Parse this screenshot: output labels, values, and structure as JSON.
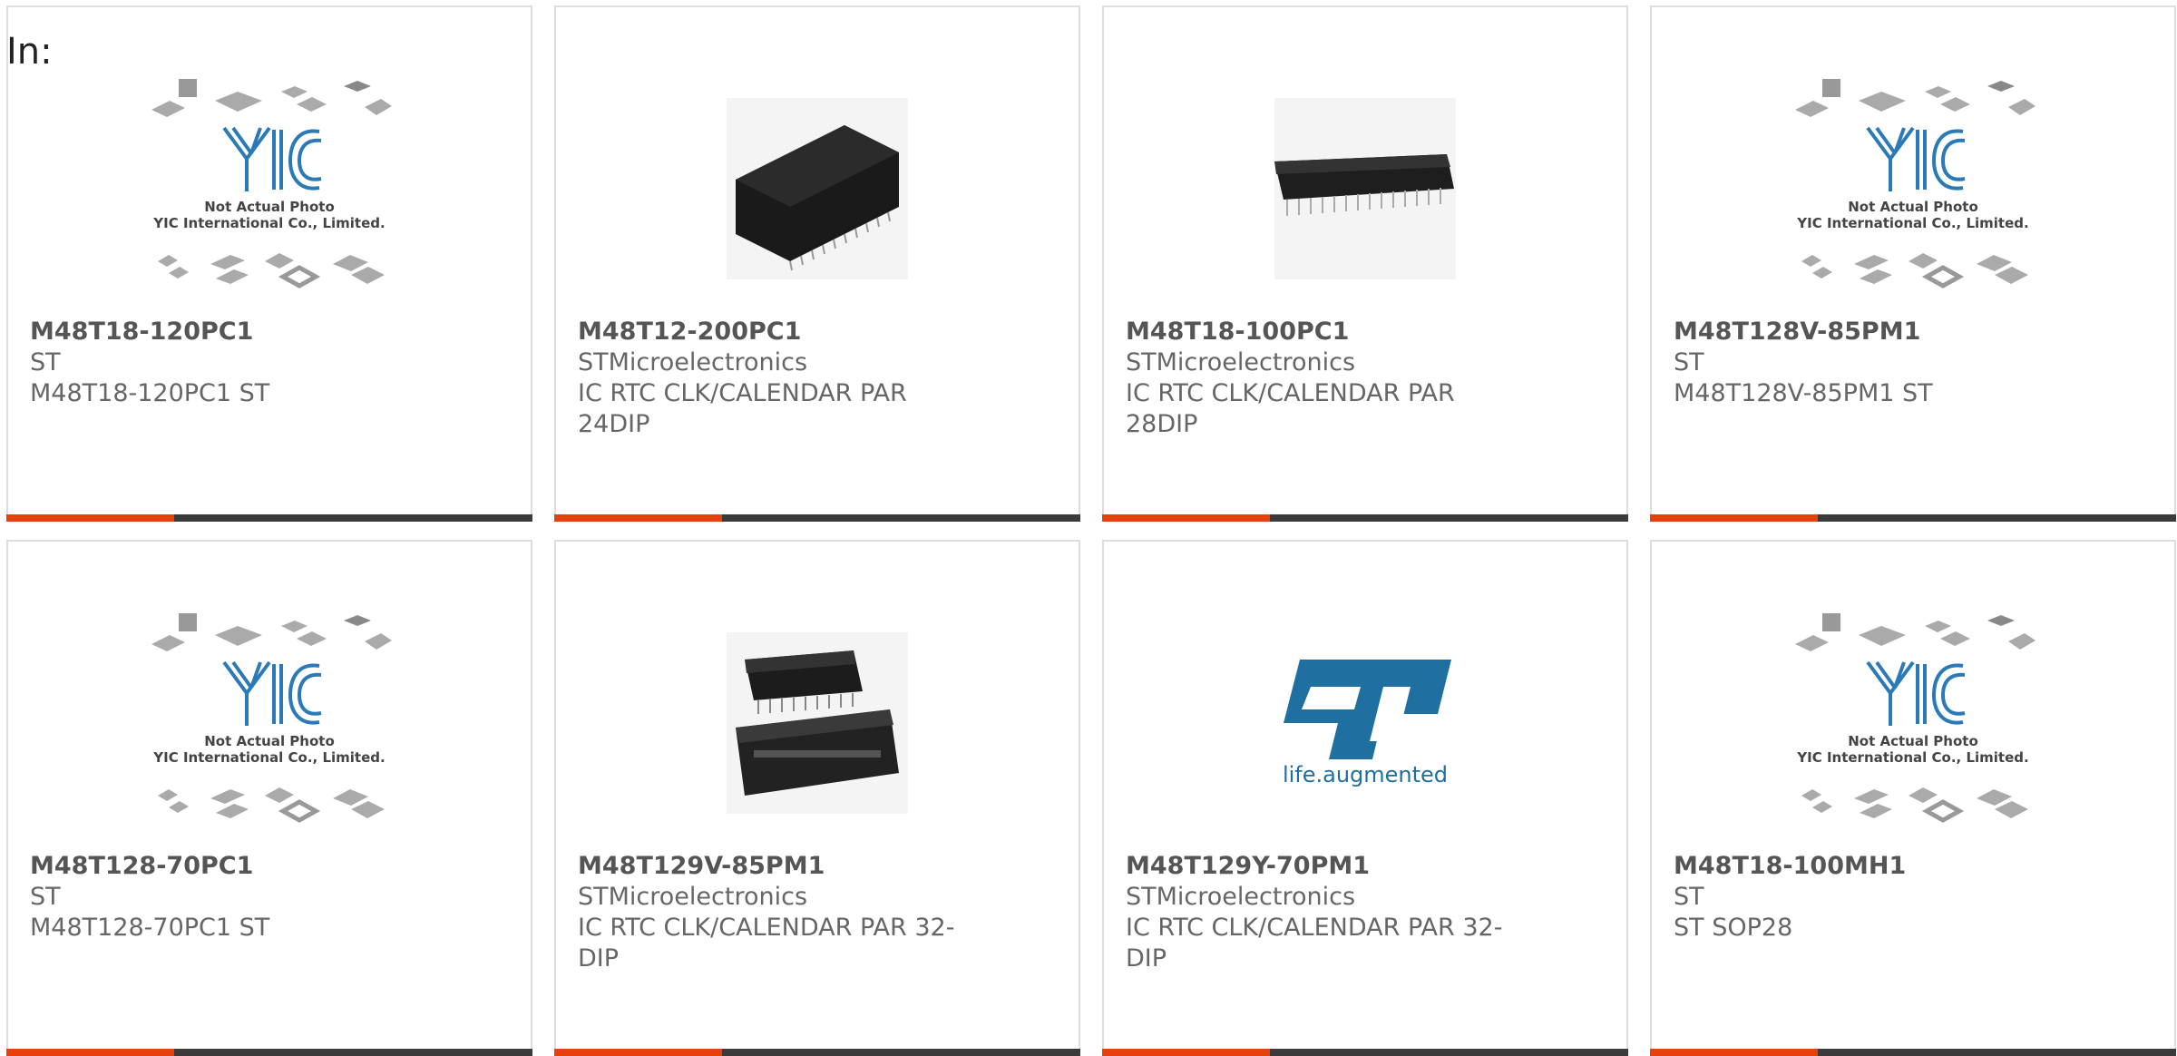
{
  "header": {
    "in_label": "In:"
  },
  "placeholder": {
    "line1": "Not Actual Photo",
    "line2": "YIC International Co., Limited."
  },
  "st_logo": {
    "text": "life.augmented"
  },
  "cards": [
    {
      "part": "M48T18-120PC1",
      "mfr": "ST",
      "desc": "M48T18-120PC1 ST",
      "image": "yic-placeholder"
    },
    {
      "part": "M48T12-200PC1",
      "mfr": "STMicroelectronics",
      "desc": "IC RTC CLK/CALENDAR PAR 24DIP",
      "image": "dip-module-chip"
    },
    {
      "part": "M48T18-100PC1",
      "mfr": "STMicroelectronics",
      "desc": "IC RTC CLK/CALENDAR PAR 28DIP",
      "image": "dip-28-chip"
    },
    {
      "part": "M48T128V-85PM1",
      "mfr": "ST",
      "desc": "M48T128V-85PM1 ST",
      "image": "yic-placeholder"
    },
    {
      "part": "M48T128-70PC1",
      "mfr": "ST",
      "desc": "M48T128-70PC1 ST",
      "image": "yic-placeholder"
    },
    {
      "part": "M48T129V-85PM1",
      "mfr": "STMicroelectronics",
      "desc": "IC RTC CLK/CALENDAR PAR 32-DIP",
      "image": "dip-32-module"
    },
    {
      "part": "M48T129Y-70PM1",
      "mfr": "STMicroelectronics",
      "desc": "IC RTC CLK/CALENDAR PAR 32-DIP",
      "image": "st-logo"
    },
    {
      "part": "M48T18-100MH1",
      "mfr": "ST",
      "desc": "ST SOP28",
      "image": "yic-placeholder"
    }
  ],
  "colors": {
    "accent": "#e8400c",
    "bar": "#3a3a3a",
    "border": "#dddddd",
    "st_blue": "#1f6fa0"
  }
}
